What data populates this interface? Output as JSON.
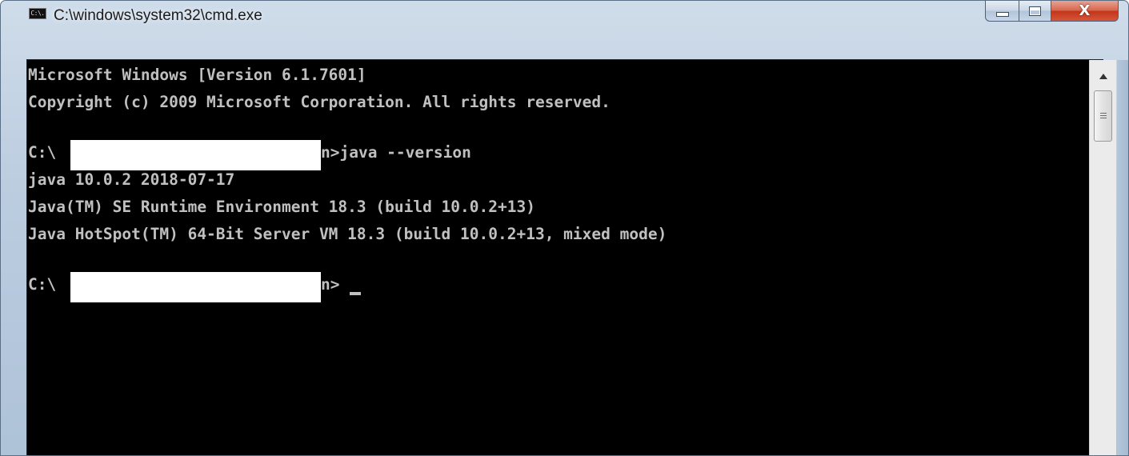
{
  "window": {
    "title": "C:\\windows\\system32\\cmd.exe",
    "icon_label": "C:\\."
  },
  "caption_buttons": {
    "minimize_icon": "minimize-icon",
    "maximize_icon": "maximize-icon",
    "close_label": "X"
  },
  "console": {
    "lines": [
      "Microsoft Windows [Version 6.1.7601]",
      "Copyright (c) 2009 Microsoft Corporation. All rights reserved.",
      "",
      "C:\\",
      "java 10.0.2 2018-07-17",
      "Java(TM) SE Runtime Environment 18.3 (build 10.0.2+13)",
      "Java HotSpot(TM) 64-Bit Server VM 18.3 (build 10.0.2+13, mixed mode)",
      "",
      "C:\\"
    ],
    "prompt1_suffix": "n>java --version",
    "prompt2_suffix": "n>"
  },
  "colors": {
    "console_bg": "#000000",
    "console_fg": "#c0c0c0",
    "close_button": "#c7401f"
  }
}
